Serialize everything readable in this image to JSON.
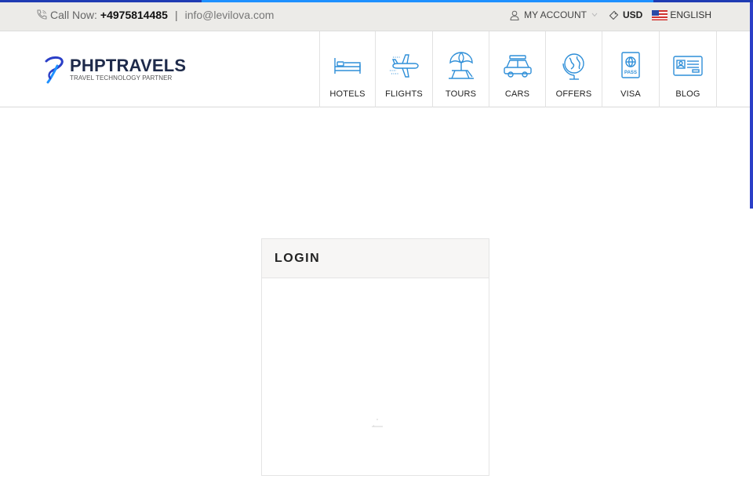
{
  "topbar": {
    "call_label": "Call Now:",
    "phone_number": "+4975814485",
    "separator": "|",
    "email": "info@levilova.com",
    "account_label": "MY ACCOUNT",
    "currency": "USD",
    "language": "ENGLISH"
  },
  "logo": {
    "brand": "PHPTRAVELS",
    "tagline": "TRAVEL TECHNOLOGY PARTNER"
  },
  "nav": {
    "items": [
      {
        "label": "HOTELS",
        "icon": "bed-icon"
      },
      {
        "label": "FLIGHTS",
        "icon": "airplane-icon"
      },
      {
        "label": "TOURS",
        "icon": "beach-umbrella-icon"
      },
      {
        "label": "CARS",
        "icon": "car-icon"
      },
      {
        "label": "OFFERS",
        "icon": "globe-icon"
      },
      {
        "label": "VISA",
        "icon": "passport-icon"
      },
      {
        "label": "BLOG",
        "icon": "id-card-icon"
      }
    ]
  },
  "login": {
    "title": "LOGIN"
  },
  "colors": {
    "accent": "#1e90ff",
    "icon_blue": "#2f8fd8",
    "brand_dark": "#1e2a4a",
    "topbar_bg": "#ecebe8",
    "progress_dark": "#1f3bb3"
  }
}
